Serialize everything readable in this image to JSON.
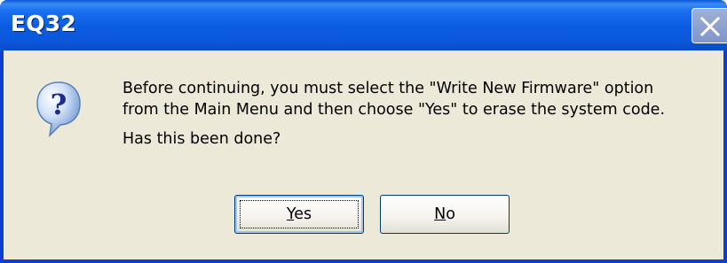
{
  "window": {
    "title": "EQ32"
  },
  "dialog": {
    "message_line1": "Before continuing, you must select the \"Write New Firmware\" option",
    "message_line2": "from the Main Menu and then choose \"Yes\" to erase the system code.",
    "prompt": "Has this been done?",
    "icon": "question-icon"
  },
  "buttons": {
    "yes_mnemonic": "Y",
    "yes_rest": "es",
    "no_mnemonic": "N",
    "no_rest": "o"
  },
  "colors": {
    "titlebar": "#0a5be0",
    "client": "#ece9d8",
    "button_border": "#003c74"
  }
}
